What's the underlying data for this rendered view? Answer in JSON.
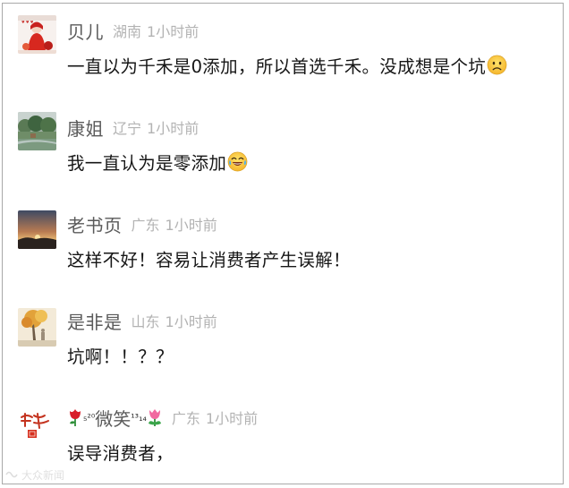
{
  "comments": [
    {
      "avatar_icon": "red-dress-girl-avatar",
      "username": "贝儿",
      "location": "湖南",
      "time": "1小时前",
      "text": "一直以为千禾是0添加，所以首选千禾。没成想是个坑",
      "emoji": "sad-face-emoji"
    },
    {
      "avatar_icon": "landscape-trees-avatar",
      "username": "康姐",
      "location": "辽宁",
      "time": "1小时前",
      "text": "我一直认为是零添加",
      "emoji": "laugh-cry-emoji"
    },
    {
      "avatar_icon": "sunset-avatar",
      "username": "老书页",
      "location": "广东",
      "time": "1小时前",
      "text": "这样不好！容易让消费者产生误解！",
      "emoji": ""
    },
    {
      "avatar_icon": "autumn-tree-avatar",
      "username": "是非是",
      "location": "山东",
      "time": "1小时前",
      "text": "坑啊！！？？",
      "emoji": ""
    },
    {
      "avatar_icon": "calligraphy-seal-avatar",
      "username_prefix_icon": "red-rose-icon",
      "username_sup1": "₅",
      "username_sup2": "²⁰",
      "username": "微笑",
      "username_sup3": "¹³",
      "username_sub": "₁₄",
      "username_suffix_icon": "tulip-icon",
      "location": "广东",
      "time": "1小时前",
      "text": "误导消费者，",
      "emoji": ""
    }
  ],
  "watermark": {
    "text": "大众新闻"
  },
  "colors": {
    "username": "#5a5a5a",
    "meta": "#b3b3b3",
    "text": "#161616",
    "border": "#a9a9a9"
  }
}
